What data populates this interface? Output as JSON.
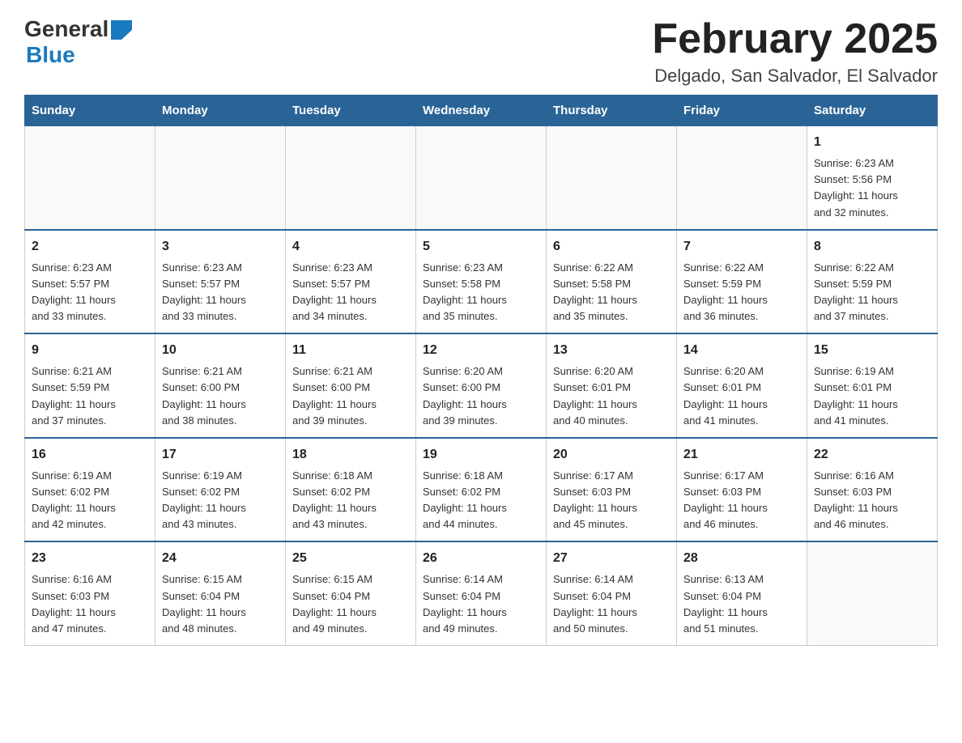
{
  "header": {
    "logo_general": "General",
    "logo_blue": "Blue",
    "month_title": "February 2025",
    "location": "Delgado, San Salvador, El Salvador"
  },
  "weekdays": [
    "Sunday",
    "Monday",
    "Tuesday",
    "Wednesday",
    "Thursday",
    "Friday",
    "Saturday"
  ],
  "weeks": [
    [
      {
        "day": "",
        "info": ""
      },
      {
        "day": "",
        "info": ""
      },
      {
        "day": "",
        "info": ""
      },
      {
        "day": "",
        "info": ""
      },
      {
        "day": "",
        "info": ""
      },
      {
        "day": "",
        "info": ""
      },
      {
        "day": "1",
        "info": "Sunrise: 6:23 AM\nSunset: 5:56 PM\nDaylight: 11 hours\nand 32 minutes."
      }
    ],
    [
      {
        "day": "2",
        "info": "Sunrise: 6:23 AM\nSunset: 5:57 PM\nDaylight: 11 hours\nand 33 minutes."
      },
      {
        "day": "3",
        "info": "Sunrise: 6:23 AM\nSunset: 5:57 PM\nDaylight: 11 hours\nand 33 minutes."
      },
      {
        "day": "4",
        "info": "Sunrise: 6:23 AM\nSunset: 5:57 PM\nDaylight: 11 hours\nand 34 minutes."
      },
      {
        "day": "5",
        "info": "Sunrise: 6:23 AM\nSunset: 5:58 PM\nDaylight: 11 hours\nand 35 minutes."
      },
      {
        "day": "6",
        "info": "Sunrise: 6:22 AM\nSunset: 5:58 PM\nDaylight: 11 hours\nand 35 minutes."
      },
      {
        "day": "7",
        "info": "Sunrise: 6:22 AM\nSunset: 5:59 PM\nDaylight: 11 hours\nand 36 minutes."
      },
      {
        "day": "8",
        "info": "Sunrise: 6:22 AM\nSunset: 5:59 PM\nDaylight: 11 hours\nand 37 minutes."
      }
    ],
    [
      {
        "day": "9",
        "info": "Sunrise: 6:21 AM\nSunset: 5:59 PM\nDaylight: 11 hours\nand 37 minutes."
      },
      {
        "day": "10",
        "info": "Sunrise: 6:21 AM\nSunset: 6:00 PM\nDaylight: 11 hours\nand 38 minutes."
      },
      {
        "day": "11",
        "info": "Sunrise: 6:21 AM\nSunset: 6:00 PM\nDaylight: 11 hours\nand 39 minutes."
      },
      {
        "day": "12",
        "info": "Sunrise: 6:20 AM\nSunset: 6:00 PM\nDaylight: 11 hours\nand 39 minutes."
      },
      {
        "day": "13",
        "info": "Sunrise: 6:20 AM\nSunset: 6:01 PM\nDaylight: 11 hours\nand 40 minutes."
      },
      {
        "day": "14",
        "info": "Sunrise: 6:20 AM\nSunset: 6:01 PM\nDaylight: 11 hours\nand 41 minutes."
      },
      {
        "day": "15",
        "info": "Sunrise: 6:19 AM\nSunset: 6:01 PM\nDaylight: 11 hours\nand 41 minutes."
      }
    ],
    [
      {
        "day": "16",
        "info": "Sunrise: 6:19 AM\nSunset: 6:02 PM\nDaylight: 11 hours\nand 42 minutes."
      },
      {
        "day": "17",
        "info": "Sunrise: 6:19 AM\nSunset: 6:02 PM\nDaylight: 11 hours\nand 43 minutes."
      },
      {
        "day": "18",
        "info": "Sunrise: 6:18 AM\nSunset: 6:02 PM\nDaylight: 11 hours\nand 43 minutes."
      },
      {
        "day": "19",
        "info": "Sunrise: 6:18 AM\nSunset: 6:02 PM\nDaylight: 11 hours\nand 44 minutes."
      },
      {
        "day": "20",
        "info": "Sunrise: 6:17 AM\nSunset: 6:03 PM\nDaylight: 11 hours\nand 45 minutes."
      },
      {
        "day": "21",
        "info": "Sunrise: 6:17 AM\nSunset: 6:03 PM\nDaylight: 11 hours\nand 46 minutes."
      },
      {
        "day": "22",
        "info": "Sunrise: 6:16 AM\nSunset: 6:03 PM\nDaylight: 11 hours\nand 46 minutes."
      }
    ],
    [
      {
        "day": "23",
        "info": "Sunrise: 6:16 AM\nSunset: 6:03 PM\nDaylight: 11 hours\nand 47 minutes."
      },
      {
        "day": "24",
        "info": "Sunrise: 6:15 AM\nSunset: 6:04 PM\nDaylight: 11 hours\nand 48 minutes."
      },
      {
        "day": "25",
        "info": "Sunrise: 6:15 AM\nSunset: 6:04 PM\nDaylight: 11 hours\nand 49 minutes."
      },
      {
        "day": "26",
        "info": "Sunrise: 6:14 AM\nSunset: 6:04 PM\nDaylight: 11 hours\nand 49 minutes."
      },
      {
        "day": "27",
        "info": "Sunrise: 6:14 AM\nSunset: 6:04 PM\nDaylight: 11 hours\nand 50 minutes."
      },
      {
        "day": "28",
        "info": "Sunrise: 6:13 AM\nSunset: 6:04 PM\nDaylight: 11 hours\nand 51 minutes."
      },
      {
        "day": "",
        "info": ""
      }
    ]
  ]
}
